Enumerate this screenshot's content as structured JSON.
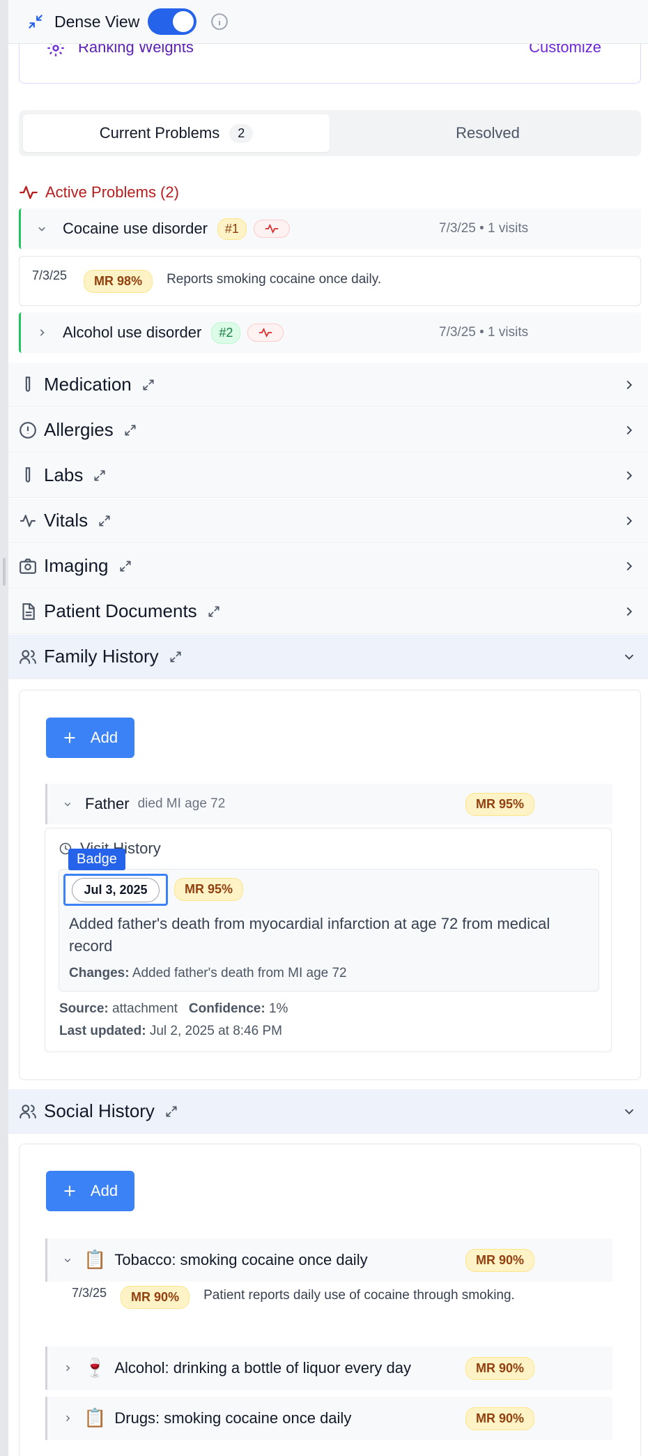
{
  "topbar": {
    "dense_view_label": "Dense View",
    "dense_view_on": true
  },
  "ranking": {
    "label": "Ranking Weights",
    "customize": "Customize"
  },
  "tabs": {
    "current_label": "Current Problems",
    "current_count": "2",
    "resolved_label": "Resolved"
  },
  "active_problems": {
    "title": "Active Problems (2)",
    "items": [
      {
        "name": "Cocaine use disorder",
        "rank": "#1",
        "meta": "7/3/25 • 1 visits",
        "detail": {
          "date": "7/3/25",
          "mr": "MR 98%",
          "note": "Reports smoking cocaine once daily."
        }
      },
      {
        "name": "Alcohol use disorder",
        "rank": "#2",
        "meta": "7/3/25 • 1 visits"
      }
    ]
  },
  "sections": [
    {
      "title": "Medication"
    },
    {
      "title": "Allergies"
    },
    {
      "title": "Labs"
    },
    {
      "title": "Vitals"
    },
    {
      "title": "Imaging"
    },
    {
      "title": "Patient Documents"
    },
    {
      "title": "Family History"
    }
  ],
  "family_history": {
    "add_label": "Add",
    "entry": {
      "relation": "Father",
      "condition": "died MI age 72",
      "mr": "MR 95%"
    },
    "visit": {
      "label": "Visit History",
      "tooltip": "Badge",
      "date": "Jul 3, 2025",
      "mr": "MR 95%",
      "text": "Added father's death from myocardial infarction at age 72 from medical record",
      "changes_label": "Changes:",
      "changes": "Added father's death from MI age 72",
      "source_label": "Source:",
      "source": "attachment",
      "confidence_label": "Confidence:",
      "confidence": "1%",
      "updated_label": "Last updated:",
      "updated": "Jul 2, 2025 at 8:46 PM"
    }
  },
  "social_history": {
    "title": "Social History",
    "add_label": "Add",
    "items": [
      {
        "emoji": "📋",
        "text": "Tobacco: smoking cocaine once daily",
        "mr": "MR 90%",
        "detail": {
          "date": "7/3/25",
          "mr": "MR 90%",
          "note": "Patient reports daily use of cocaine through smoking."
        }
      },
      {
        "emoji": "🍷",
        "text": "Alcohol: drinking a bottle of liquor every day",
        "mr": "MR 90%"
      },
      {
        "emoji": "📋",
        "text": "Drugs: smoking cocaine once daily",
        "mr": "MR 90%"
      }
    ]
  },
  "colors": {
    "accent": "#2563eb",
    "problem_red": "#b91c1c",
    "mr_bg": "#fef3c7",
    "active_border": "#22c55e"
  }
}
